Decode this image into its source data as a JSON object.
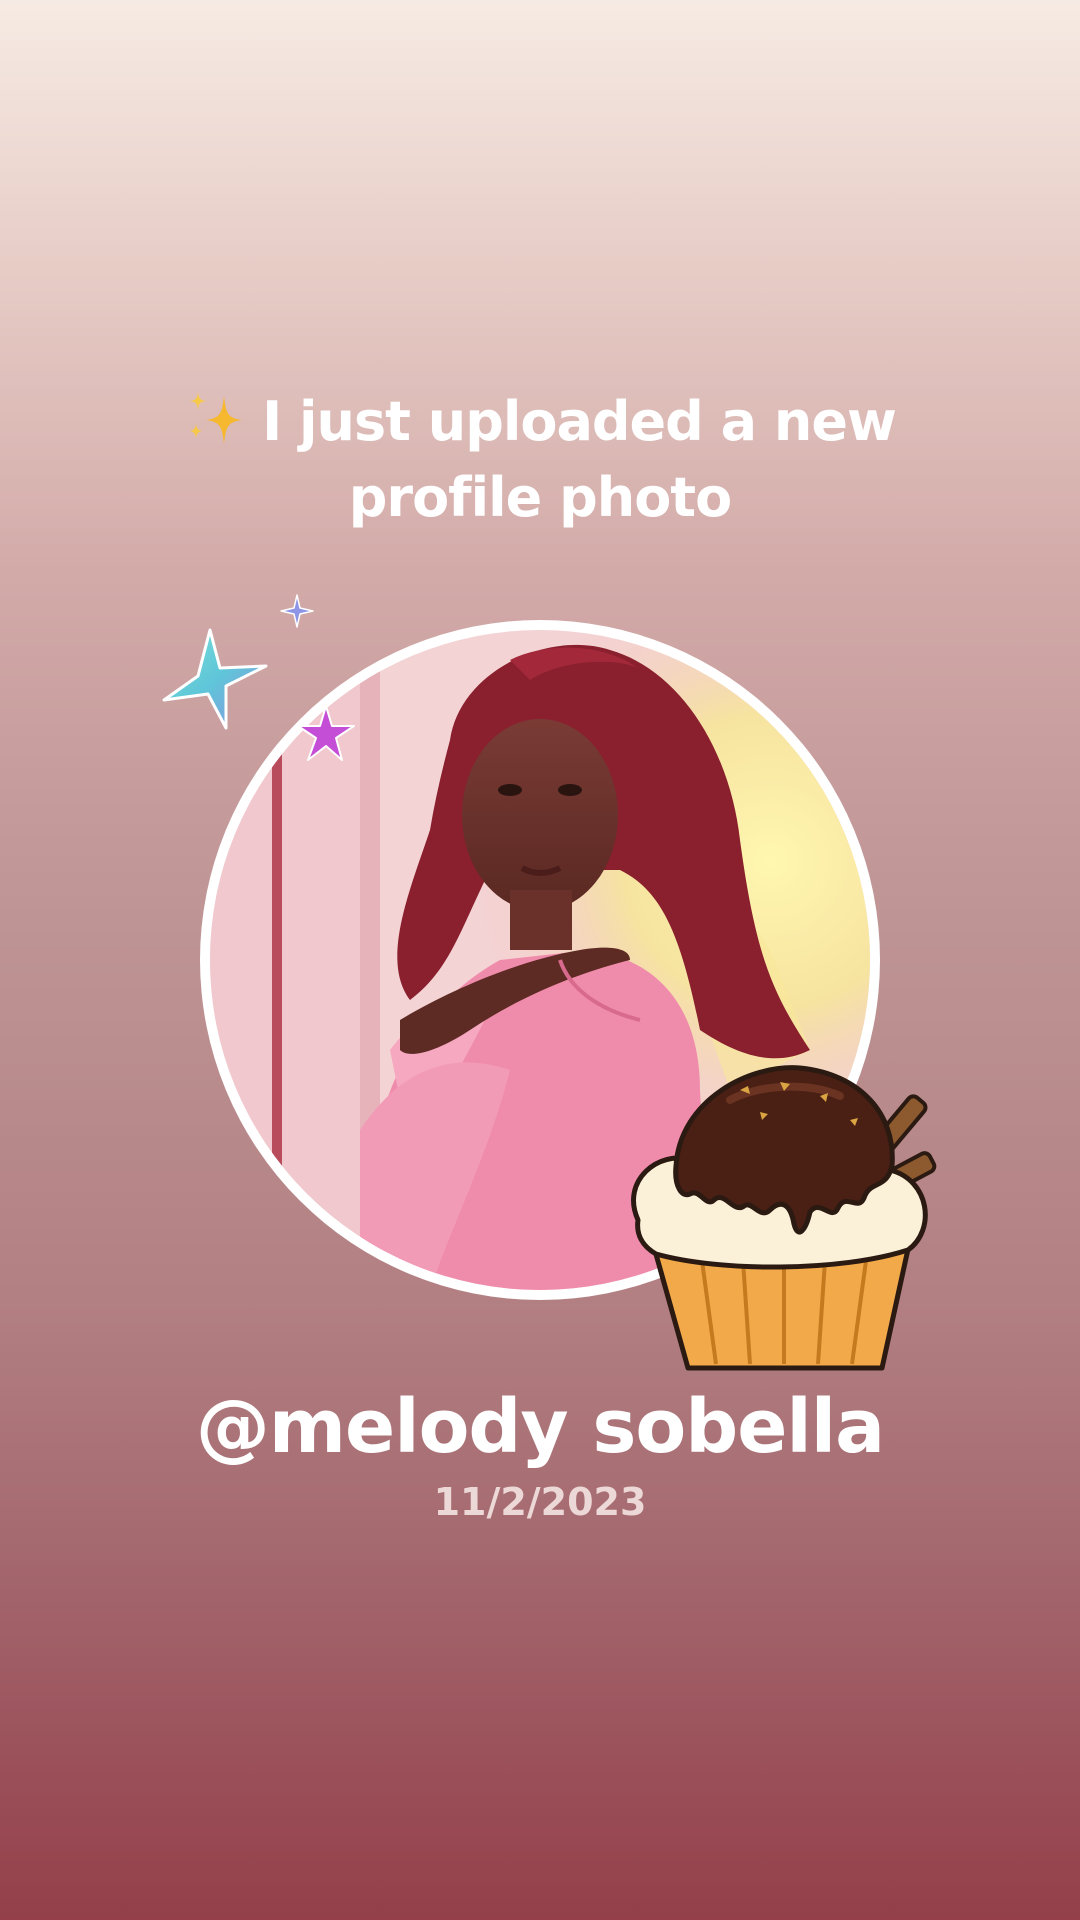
{
  "story": {
    "headline_emoji": "sparkles-icon",
    "headline_text": "I just uploaded a new profile photo",
    "username": "@melody sobella",
    "date": "11/2/2023"
  },
  "decorations": {
    "stars": [
      "teal-star-icon",
      "blue-star-icon",
      "purple-star-icon"
    ],
    "sticker": "cupcake-sticker-icon"
  },
  "colors": {
    "background_top": "#f6ebe4",
    "background_bottom": "#943f4a",
    "text": "#ffffff",
    "date_text": "#ecd8d6"
  }
}
